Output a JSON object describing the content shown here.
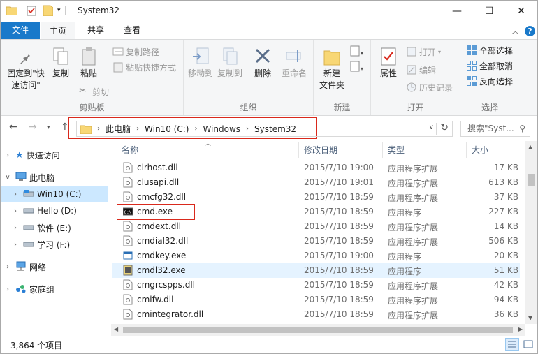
{
  "window": {
    "title": "System32",
    "minimize": "—",
    "maximize": "☐",
    "close": "✕"
  },
  "tabs": {
    "file": "文件",
    "home": "主页",
    "share": "共享",
    "view": "查看"
  },
  "ribbon": {
    "clipboard": {
      "label": "剪贴板",
      "pin": "固定到\"快速访问\"",
      "copy": "复制",
      "paste": "粘贴",
      "cut": "剪切",
      "copy_path": "复制路径",
      "paste_shortcut": "粘贴快捷方式"
    },
    "organize": {
      "label": "组织",
      "move_to": "移动到",
      "copy_to": "复制到",
      "delete": "删除",
      "rename": "重命名"
    },
    "new": {
      "label": "新建",
      "new_folder": "新建\n文件夹"
    },
    "open": {
      "label": "打开",
      "properties": "属性",
      "open": "打开",
      "edit": "编辑",
      "history": "历史记录"
    },
    "select": {
      "label": "选择",
      "select_all": "全部选择",
      "select_none": "全部取消",
      "invert": "反向选择"
    }
  },
  "address": {
    "crumbs": [
      "此电脑",
      "Win10 (C:)",
      "Windows",
      "System32"
    ],
    "search_placeholder": "搜索\"Syst..."
  },
  "nav": [
    {
      "label": "快速访问",
      "icon": "star-icon",
      "level": 0
    },
    {
      "label": "此电脑",
      "icon": "computer-icon",
      "level": 0,
      "expanded": true
    },
    {
      "label": "Win10 (C:)",
      "icon": "drive-icon",
      "level": 1,
      "selected": true
    },
    {
      "label": "Hello (D:)",
      "icon": "drive-icon",
      "level": 1
    },
    {
      "label": "软件 (E:)",
      "icon": "drive-icon",
      "level": 1
    },
    {
      "label": "学习 (F:)",
      "icon": "drive-icon",
      "level": 1
    },
    {
      "label": "网络",
      "icon": "network-icon",
      "level": 0
    },
    {
      "label": "家庭组",
      "icon": "homegroup-icon",
      "level": 0
    }
  ],
  "columns": {
    "name": "名称",
    "date": "修改日期",
    "type": "类型",
    "size": "大小"
  },
  "files": [
    {
      "name": "clrhost.dll",
      "date": "2015/7/10 19:00",
      "type": "应用程序扩展",
      "size": "17 KB",
      "icon": "dll-icon"
    },
    {
      "name": "clusapi.dll",
      "date": "2015/7/10 19:01",
      "type": "应用程序扩展",
      "size": "613 KB",
      "icon": "dll-icon"
    },
    {
      "name": "cmcfg32.dll",
      "date": "2015/7/10 18:59",
      "type": "应用程序扩展",
      "size": "37 KB",
      "icon": "dll-icon"
    },
    {
      "name": "cmd.exe",
      "date": "2015/7/10 18:59",
      "type": "应用程序",
      "size": "227 KB",
      "icon": "cmd-icon"
    },
    {
      "name": "cmdext.dll",
      "date": "2015/7/10 18:59",
      "type": "应用程序扩展",
      "size": "14 KB",
      "icon": "dll-icon"
    },
    {
      "name": "cmdial32.dll",
      "date": "2015/7/10 18:59",
      "type": "应用程序扩展",
      "size": "506 KB",
      "icon": "dll-icon"
    },
    {
      "name": "cmdkey.exe",
      "date": "2015/7/10 19:00",
      "type": "应用程序",
      "size": "20 KB",
      "icon": "exe-icon"
    },
    {
      "name": "cmdl32.exe",
      "date": "2015/7/10 18:59",
      "type": "应用程序",
      "size": "51 KB",
      "icon": "cmdl-icon",
      "highlight": true
    },
    {
      "name": "cmgrcspps.dll",
      "date": "2015/7/10 18:59",
      "type": "应用程序扩展",
      "size": "42 KB",
      "icon": "dll-icon"
    },
    {
      "name": "cmifw.dll",
      "date": "2015/7/10 18:59",
      "type": "应用程序扩展",
      "size": "94 KB",
      "icon": "dll-icon"
    },
    {
      "name": "cmintegrator.dll",
      "date": "2015/7/10 18:59",
      "type": "应用程序扩展",
      "size": "36 KB",
      "icon": "dll-icon"
    }
  ],
  "status": {
    "count": "3,864 个项目"
  },
  "colors": {
    "accent": "#1979ca",
    "selected": "#cce8ff",
    "hover": "#e5f3ff",
    "annotation": "#d9291c"
  }
}
